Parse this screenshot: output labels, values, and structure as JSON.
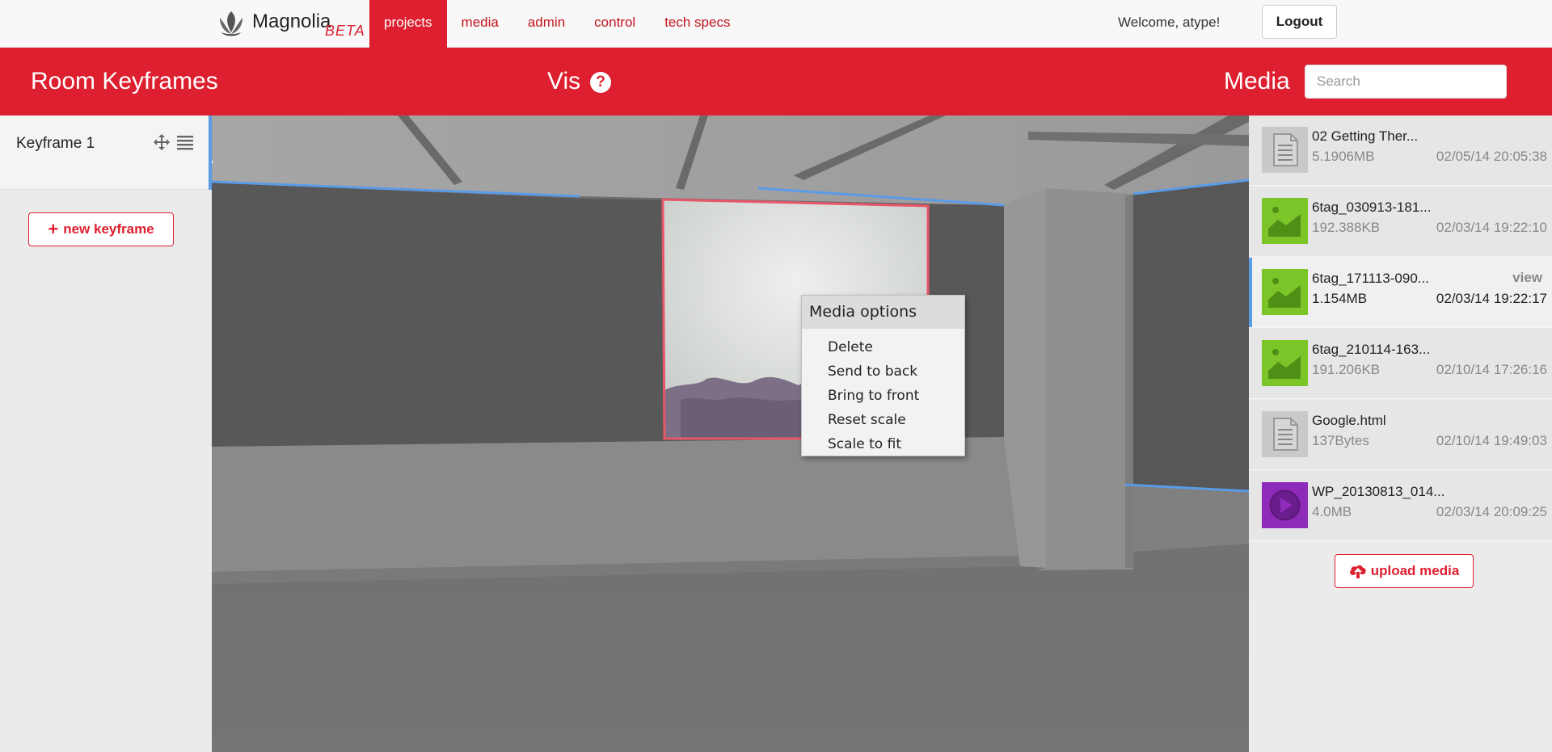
{
  "brand": {
    "name": "Magnolia",
    "beta": "BETA"
  },
  "nav": [
    {
      "label": "projects",
      "active": true
    },
    {
      "label": "media",
      "active": false
    },
    {
      "label": "admin",
      "active": false
    },
    {
      "label": "control",
      "active": false
    },
    {
      "label": "tech specs",
      "active": false
    }
  ],
  "user": {
    "welcome": "Welcome, atype!",
    "logout_label": "Logout"
  },
  "header": {
    "keyframes_title": "Room Keyframes",
    "vis_title": "Vis",
    "help_glyph": "?",
    "media_title": "Media",
    "search_placeholder": "Search"
  },
  "keyframes": {
    "items": [
      {
        "label": "Keyframe 1"
      }
    ],
    "new_label": "new keyframe",
    "new_icon": "+"
  },
  "context_menu": {
    "title": "Media options",
    "items": [
      "Delete",
      "Send to back",
      "Bring to front",
      "Reset scale",
      "Scale to fit"
    ]
  },
  "media": {
    "items": [
      {
        "name": "02 Getting Ther...",
        "size": "5.1906MB",
        "date": "02/05/14 20:05:38",
        "type": "document",
        "selected": false
      },
      {
        "name": "6tag_030913-181...",
        "size": "192.388KB",
        "date": "02/03/14 19:22:10",
        "type": "image",
        "selected": false
      },
      {
        "name": "6tag_171113-090...",
        "size": "1.154MB",
        "date": "02/03/14 19:22:17",
        "type": "image",
        "selected": true,
        "action": "view"
      },
      {
        "name": "6tag_210114-163...",
        "size": "191.206KB",
        "date": "02/10/14 17:26:16",
        "type": "image",
        "selected": false
      },
      {
        "name": "Google.html",
        "size": "137Bytes",
        "date": "02/10/14 19:49:03",
        "type": "document",
        "selected": false
      },
      {
        "name": "WP_20130813_014...",
        "size": "4.0MB",
        "date": "02/03/14 20:09:25",
        "type": "video",
        "selected": false
      }
    ],
    "upload_label": "upload media"
  },
  "colors": {
    "brand_red": "#dd1f2f",
    "selection_blue": "#5a9be8",
    "image_thumb": "#7bc529",
    "video_thumb": "#8e2bb8",
    "doc_thumb": "#c9c9c9"
  }
}
